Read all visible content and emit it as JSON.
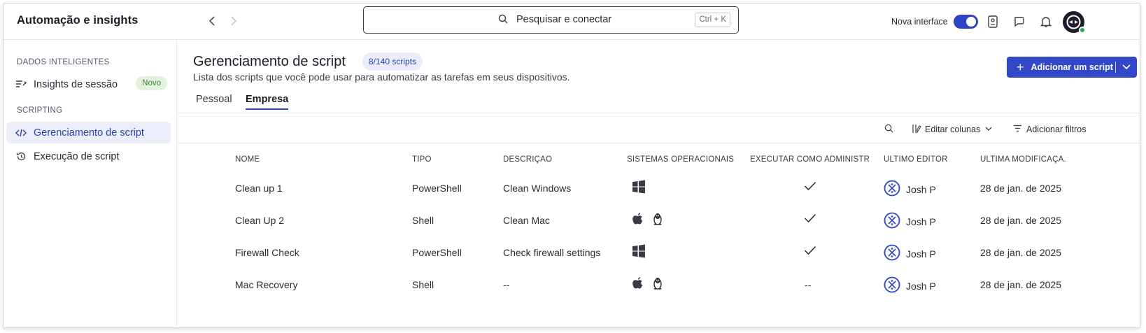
{
  "app": {
    "title": "Automação e insights"
  },
  "search": {
    "placeholder": "Pesquisar e conectar",
    "shortcut": "Ctrl + K"
  },
  "topbar": {
    "toggle_label": "Nova interface",
    "toggle_on": true
  },
  "sidebar": {
    "sections": [
      {
        "title": "DADOS INTELIGENTES",
        "items": [
          {
            "label": "Insights de sessão",
            "badge": "Novo",
            "icon": "insights-icon"
          }
        ]
      },
      {
        "title": "SCRIPTING",
        "items": [
          {
            "label": "Gerenciamento de script",
            "icon": "code-icon",
            "active": true
          },
          {
            "label": "Execução de script",
            "icon": "history-icon"
          }
        ]
      }
    ]
  },
  "main": {
    "title": "Gerenciamento de script",
    "count_badge": "8/140 scripts",
    "subtitle": "Lista dos scripts que você pode usar para automatizar as tarefas em seus dispositivos.",
    "add_button": "Adicionar um script",
    "tabs": [
      {
        "label": "Pessoal"
      },
      {
        "label": "Empresa",
        "active": true
      }
    ],
    "toolbar": {
      "edit_columns": "Editar colunas",
      "add_filters": "Adicionar filtros"
    },
    "table": {
      "headers": [
        "NOME",
        "TIPO",
        "DESCRIÇÃO",
        "SISTEMAS OPERACIONAIS",
        "EXECUTAR COMO ADMINISTR...",
        "ÚLTIMO EDITOR",
        "ÚLTIMA MODIFICAÇÃ..."
      ],
      "rows": [
        {
          "name": "Clean up 1",
          "type": "PowerShell",
          "description": "Clean Windows",
          "os": [
            "windows-icon"
          ],
          "admin": "check",
          "editor": "Josh P",
          "modified": "28 de jan. de 2025"
        },
        {
          "name": "Clean Up 2",
          "type": "Shell",
          "description": "Clean Mac",
          "os": [
            "apple-icon",
            "linux-icon"
          ],
          "admin": "check",
          "editor": "Josh P",
          "modified": "28 de jan. de 2025"
        },
        {
          "name": "Firewall Check",
          "type": "PowerShell",
          "description": "Check firewall settings",
          "os": [
            "windows-icon"
          ],
          "admin": "check",
          "editor": "Josh P",
          "modified": "28 de jan. de 2025"
        },
        {
          "name": "Mac Recovery",
          "type": "Shell",
          "description": "--",
          "os": [
            "apple-icon",
            "linux-icon"
          ],
          "admin": "--",
          "editor": "Josh P",
          "modified": "28 de jan. de 2025"
        }
      ]
    }
  },
  "colors": {
    "accent": "#3347c9",
    "active_bg": "#eceffb",
    "badge_green_bg": "#e3f2dc"
  }
}
